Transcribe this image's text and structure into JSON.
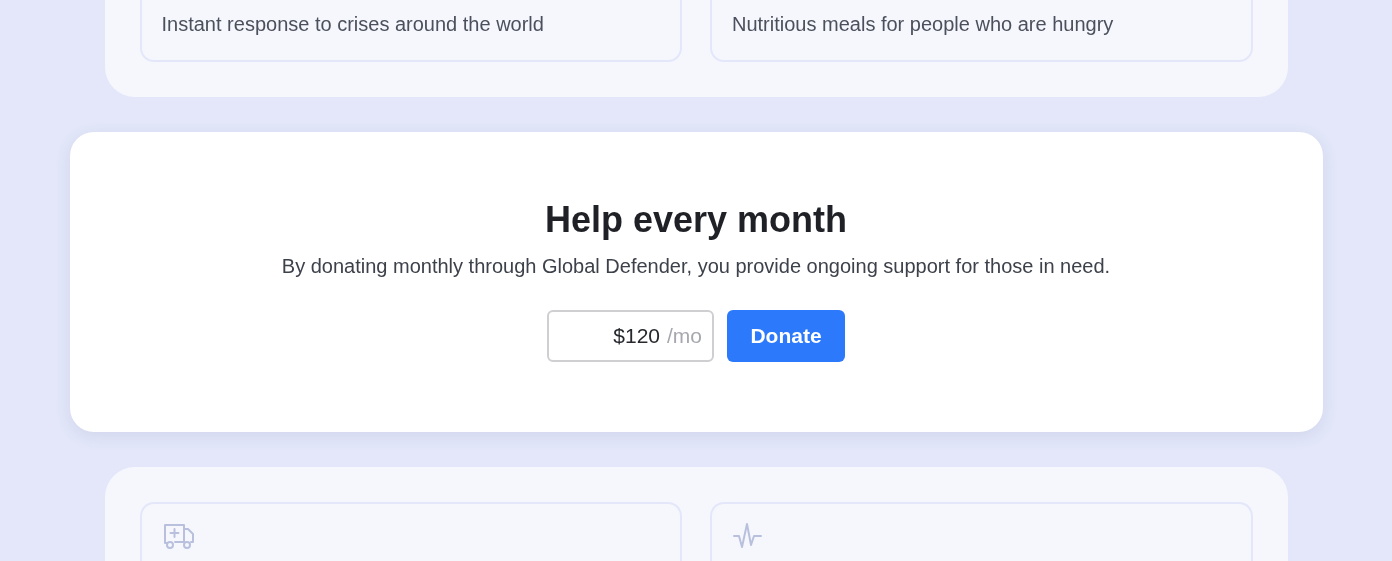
{
  "top_cards": [
    {
      "description": "Instant response to crises around the world"
    },
    {
      "description": "Nutritious meals for people who are hungry"
    }
  ],
  "monthly": {
    "title": "Help every month",
    "text": "By donating monthly through Global Defender, you provide ongoing support for those in need.",
    "amount": "$120",
    "unit": "/mo",
    "button": "Donate"
  },
  "bottom_cards": [
    {
      "kind": "ambulance"
    },
    {
      "kind": "pulse"
    }
  ]
}
